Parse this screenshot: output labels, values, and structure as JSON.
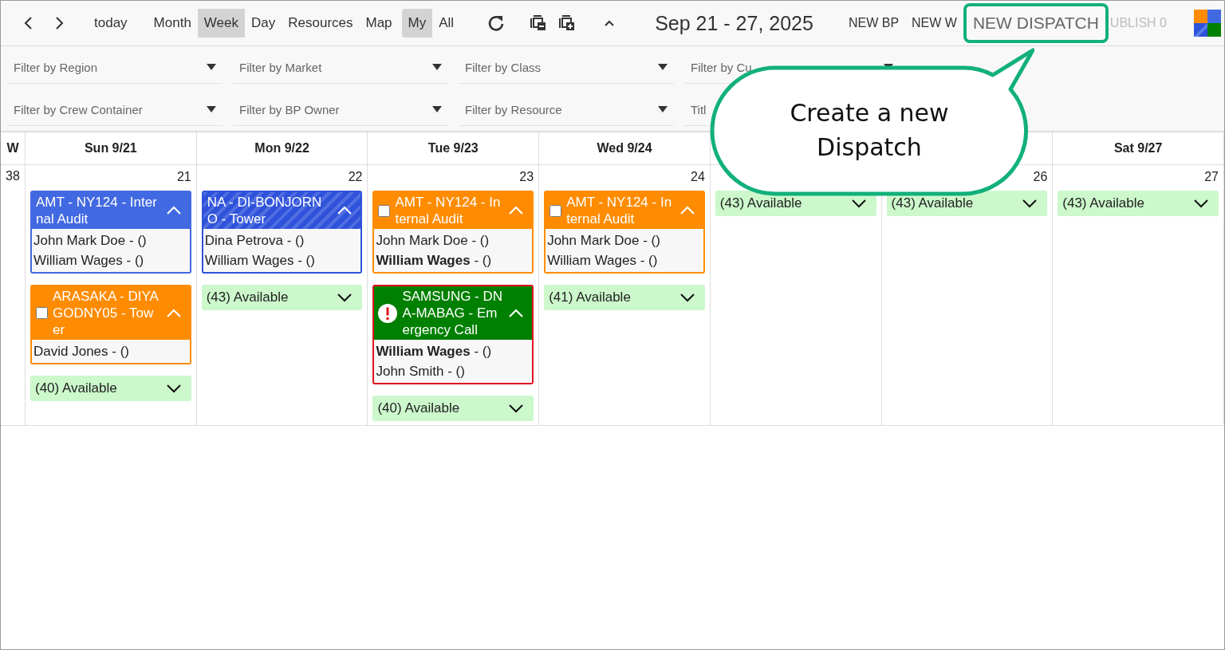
{
  "toolbar": {
    "today": "today",
    "views": [
      {
        "label": "Month",
        "selected": false
      },
      {
        "label": "Week",
        "selected": true
      },
      {
        "label": "Day",
        "selected": false
      },
      {
        "label": "Resources",
        "selected": false
      },
      {
        "label": "Map",
        "selected": false
      }
    ],
    "scopes": [
      {
        "label": "My",
        "selected": true
      },
      {
        "label": "All",
        "selected": false
      }
    ],
    "title": "Sep 21 - 27, 2025",
    "actions": [
      {
        "label": "NEW BP",
        "highlighted": false,
        "disabled": false
      },
      {
        "label": "NEW W",
        "highlighted": false,
        "disabled": false
      },
      {
        "label": "NEW DISPATCH",
        "highlighted": true,
        "disabled": false
      },
      {
        "label": "UBLISH 0",
        "highlighted": false,
        "disabled": true
      }
    ]
  },
  "filters": [
    [
      {
        "placeholder": "Filter by Region",
        "kind": "select"
      },
      {
        "placeholder": "Filter by Market",
        "kind": "select"
      },
      {
        "placeholder": "Filter by Class",
        "kind": "select"
      },
      {
        "placeholder": "Filter by Cu",
        "kind": "select"
      }
    ],
    [
      {
        "placeholder": "Filter by Crew Container",
        "kind": "select"
      },
      {
        "placeholder": "Filter by BP Owner",
        "kind": "select"
      },
      {
        "placeholder": "Filter by Resource",
        "kind": "select"
      },
      {
        "placeholder": "Titl",
        "kind": "text"
      }
    ]
  ],
  "calendar": {
    "week_header": "W",
    "week_number": "38",
    "days": [
      {
        "header": "Sun 9/21",
        "number": "21",
        "available": "(40) Available",
        "events": [
          {
            "title": "AMT - NY124 - Internal Audit",
            "color": "#4169e1",
            "striped": false,
            "alert": false,
            "crew": [
              "John Mark Doe - ()",
              "William Wages - ()"
            ]
          },
          {
            "title": "ARASAKA - DIYAGODNY05 - Tower",
            "color": "#ff8c00",
            "striped": false,
            "alert": false,
            "checked": false,
            "crew": [
              "David Jones - ()"
            ]
          }
        ]
      },
      {
        "header": "Mon 9/22",
        "number": "22",
        "available": "(43) Available",
        "events": [
          {
            "title": "NA - DI-BONJORNO - Tower",
            "color": "#2f52db",
            "striped": true,
            "alert": false,
            "crew": [
              "Dina Petrova - ()",
              "William Wages - ()"
            ]
          }
        ]
      },
      {
        "header": "Tue 9/23",
        "number": "23",
        "available": "(40) Available",
        "events": [
          {
            "title": "AMT - NY124 - Internal Audit",
            "color": "#ff8c00",
            "striped": false,
            "alert": false,
            "checked": false,
            "crew": [
              "John Mark Doe - ()",
              "**William Wages** - ()"
            ]
          },
          {
            "title": "SAMSUNG - DNA-MABAG - Emergency Call",
            "color": "#008000",
            "striped": false,
            "alert": true,
            "crew": [
              "**William Wages** - ()",
              "John Smith - ()"
            ]
          }
        ]
      },
      {
        "header": "Wed 9/24",
        "number": "24",
        "available": "(41) Available",
        "events": [
          {
            "title": "AMT - NY124 - Internal Audit",
            "color": "#ff8c00",
            "striped": false,
            "alert": false,
            "checked": false,
            "crew": [
              "John Mark Doe - ()",
              "William Wages - ()"
            ]
          }
        ]
      },
      {
        "available": "(43) Available"
      },
      {
        "number": "26",
        "available": "(43) Available"
      },
      {
        "header": "Sat 9/27",
        "number": "27",
        "available": "(43) Available"
      }
    ]
  },
  "callout": {
    "text": "Create a new Dispatch"
  }
}
